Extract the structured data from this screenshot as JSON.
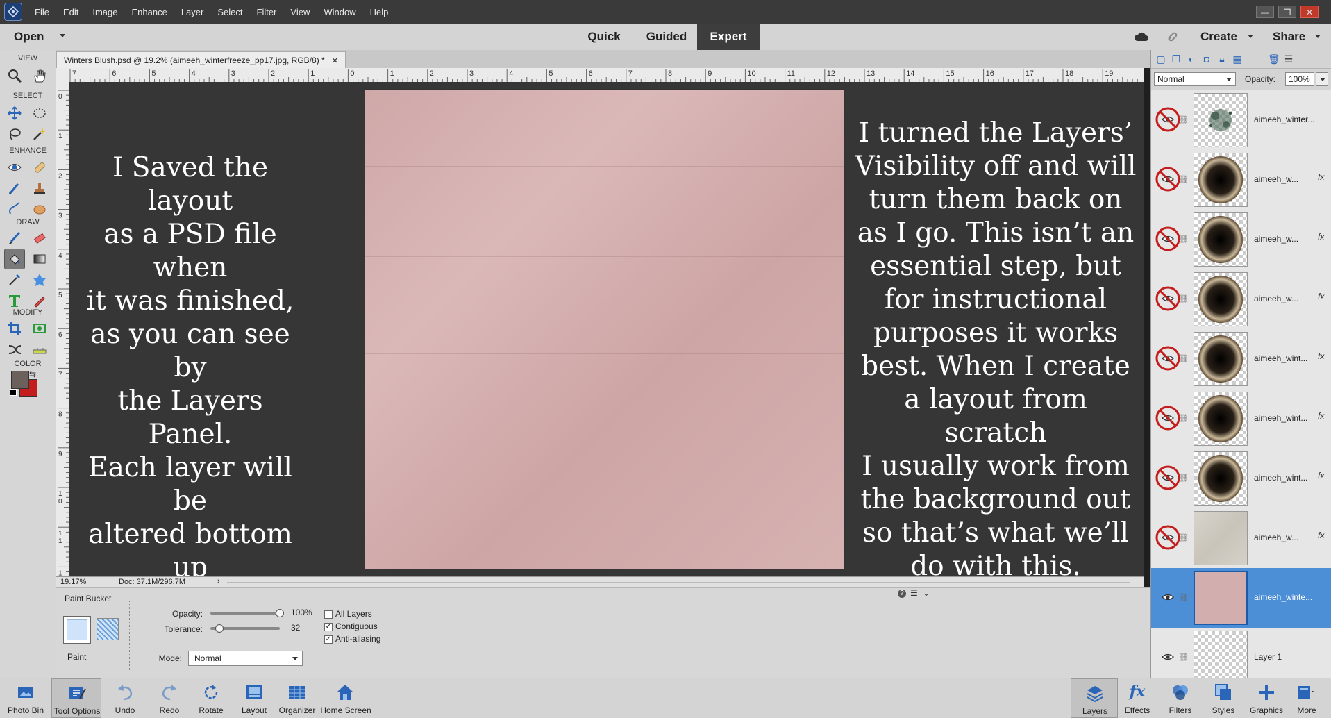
{
  "menubar": {
    "items": [
      "File",
      "Edit",
      "Image",
      "Enhance",
      "Layer",
      "Select",
      "Filter",
      "View",
      "Window",
      "Help"
    ],
    "window_controls": [
      "—",
      "❐",
      "✕"
    ]
  },
  "modebar": {
    "open_label": "Open",
    "tabs": [
      "Quick",
      "Guided",
      "Expert"
    ],
    "active_tab": "Expert",
    "create_label": "Create",
    "share_label": "Share"
  },
  "toolbox": {
    "sections": [
      "VIEW",
      "SELECT",
      "ENHANCE",
      "DRAW",
      "MODIFY",
      "COLOR"
    ],
    "foreground_color": "#6b605c",
    "background_color": "#c41d1d"
  },
  "document": {
    "tab_title": "Winters Blush.psd @ 19.2% (aimeeh_winterfreeze_pp17.jpg, RGB/8) *",
    "ruler_top": [
      "7",
      "6",
      "5",
      "4",
      "3",
      "2",
      "1",
      "0",
      "1",
      "2",
      "3",
      "4",
      "5",
      "6",
      "7",
      "8",
      "9",
      "10",
      "11",
      "12",
      "13",
      "14",
      "15",
      "16",
      "17",
      "18",
      "19"
    ],
    "ruler_left": [
      "0",
      "1",
      "2",
      "3",
      "4",
      "5",
      "6",
      "7",
      "8",
      "9",
      "1\n0",
      "1\n1",
      "1\n2"
    ],
    "caption_left": "I Saved the layout\nas a PSD file when\nit was finished,\nas you can see by\nthe Layers Panel.\nEach layer will be\naltered bottom up\nto create generic\nplaceholders for\nfuture use.",
    "caption_right": "I turned the Layers’\nVisibility off and will\nturn them back on\nas I go. This isn’t an\nessential step, but\nfor instructional\npurposes it works\nbest. When I create\na layout from scratch\nI usually work from\nthe background out\nso that’s what we’ll\ndo with this.",
    "paper_color": "#d3aeae"
  },
  "status": {
    "zoom": "19.17%",
    "doc": "Doc: 37.1M/296.7M"
  },
  "tool_options": {
    "tool_name": "Paint Bucket",
    "paint_label": "Paint",
    "opacity_label": "Opacity:",
    "opacity_value": "100%",
    "opacity_fraction": 1.0,
    "tolerance_label": "Tolerance:",
    "tolerance_value": "32",
    "tolerance_fraction": 0.13,
    "mode_label": "Mode:",
    "mode_value": "Normal",
    "checkboxes": [
      {
        "label": "All Layers",
        "checked": false
      },
      {
        "label": "Contiguous",
        "checked": true
      },
      {
        "label": "Anti-aliasing",
        "checked": true
      }
    ]
  },
  "layers": {
    "blend_mode": "Normal",
    "opacity_label": "Opacity:",
    "opacity_value": "100%",
    "items": [
      {
        "name": "aimeeh_winter...",
        "fx": "",
        "visible": false,
        "thumb": "splatter"
      },
      {
        "name": "aimeeh_w...",
        "fx": "fx",
        "visible": false,
        "thumb": "frame"
      },
      {
        "name": "aimeeh_w...",
        "fx": "fx",
        "visible": false,
        "thumb": "frame"
      },
      {
        "name": "aimeeh_w...",
        "fx": "fx",
        "visible": false,
        "thumb": "frame"
      },
      {
        "name": "aimeeh_wint...",
        "fx": "fx",
        "visible": false,
        "thumb": "frame"
      },
      {
        "name": "aimeeh_wint...",
        "fx": "fx",
        "visible": false,
        "thumb": "frame"
      },
      {
        "name": "aimeeh_wint...",
        "fx": "fx",
        "visible": false,
        "thumb": "frame"
      },
      {
        "name": "aimeeh_w...",
        "fx": "fx",
        "visible": false,
        "thumb": "texture"
      },
      {
        "name": "aimeeh_winte...",
        "fx": "",
        "visible": true,
        "thumb": "pink",
        "selected": true
      },
      {
        "name": "Layer 1",
        "fx": "",
        "visible": true,
        "thumb": "empty"
      }
    ]
  },
  "bottombar": {
    "left_items": [
      "Photo Bin",
      "Tool Options",
      "Undo",
      "Redo",
      "Rotate",
      "Layout",
      "Organizer",
      "Home Screen"
    ],
    "right_items": [
      "Layers",
      "Effects",
      "Filters",
      "Styles",
      "Graphics",
      "More"
    ]
  },
  "colors": {
    "accent": "#2a65b8",
    "selected_layer": "#4d8fd6",
    "no_visibility": "#c41d1d"
  }
}
